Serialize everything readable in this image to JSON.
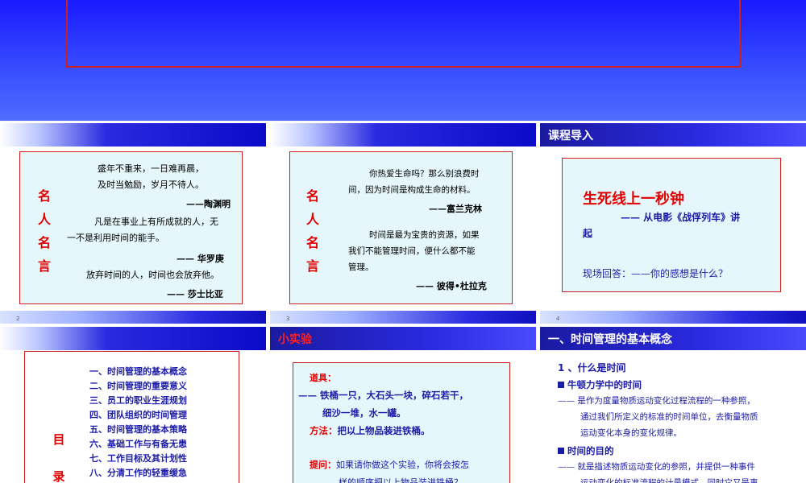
{
  "slide_hero": {
    "border_color": "#cc2020"
  },
  "slide2": {
    "page": "2",
    "vertical_title": [
      "名",
      "人",
      "名",
      "言"
    ],
    "lines": [
      "盛年不重来，一日难再晨，",
      "及时当勉励，岁月不待人。",
      "——陶渊明",
      "凡是在事业上有所成就的人，无",
      "一不是利用时间的能手。",
      "—— 华罗庚",
      "放弃时间的人，时间也会放弃他。",
      "—— 莎士比亚"
    ]
  },
  "slide3": {
    "page": "3",
    "vertical_title": [
      "名",
      "人",
      "名",
      "言"
    ],
    "lines": [
      "你热爱生命吗？那么别浪费时",
      "间，因为时间是构成生命的材料。",
      "——富兰克林",
      "时间是最为宝贵的资源，如果",
      "我们不能管理时间，便什么都不能",
      "管理。",
      "—— 彼得•杜拉克"
    ]
  },
  "slide4": {
    "page": "4",
    "header": "课程导入",
    "title": "生死线上一秒钟",
    "subtitle_1": "—— 从电影《战俘列车》讲",
    "subtitle_2": "起",
    "question": "现场回答：——你的感想是什么？"
  },
  "slide5": {
    "vertical_title": [
      "目",
      "录"
    ],
    "items": [
      "一、时间管理的基本概念",
      "二、时间管理的重要意义",
      "三、员工的职业生涯规划",
      "四、团队组织的时间管理",
      "五、时间管理的基本策略",
      "六、基础工作与有备无患",
      "七、工作目标及其计划性",
      "八、分清工作的轻重缓急"
    ]
  },
  "slide6": {
    "header": "小实验",
    "tools_label": "道具：",
    "tools_1": "—— 铁桶一只，大石头一块，碎石若干，",
    "tools_2": "细沙一堆，水一罐。",
    "method_label": "方法：",
    "method": "把以上物品装进铁桶。",
    "question_label": "提问：",
    "question_1": "如果请你做这个实验，你将会按怎",
    "question_2": "样的顺序把以上物品装进铁桶？"
  },
  "slide7": {
    "header": "一、时间管理的基本概念",
    "section": "1 、什么是时间",
    "bullet1": "牛顿力学中的时间",
    "text1_1": "—— 是作为度量物质运动变化过程流程的一种参照，",
    "text1_2": "通过我们所定义的标准的时间单位，去衡量物质",
    "text1_3": "运动变化本身的变化规律。",
    "bullet2": "时间的目的",
    "text2_1": "—— 就是描述物质运动变化的参照，并提供一种事件",
    "text2_2": "运动变化的标准流程的计量模式，同时它又是事"
  }
}
